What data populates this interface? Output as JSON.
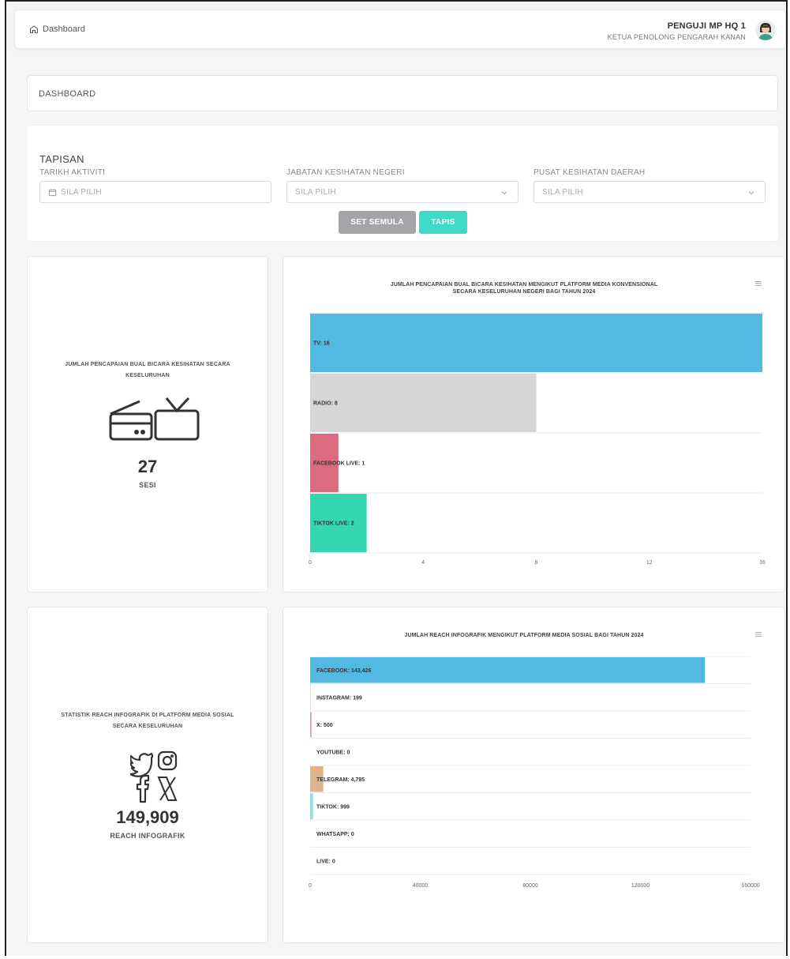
{
  "header": {
    "breadcrumb": "Dashboard",
    "user_name": "PENGUJI MP HQ 1",
    "user_role": "KETUA PENOLONG PENGARAH KANAN"
  },
  "page_title": "DASHBOARD",
  "filter": {
    "title": "TAPISAN",
    "fields": [
      {
        "label": "TARIKH AKTIVITI",
        "placeholder": "SILA PILIH"
      },
      {
        "label": "JABATAN KESIHATAN NEGERI",
        "placeholder": "SILA PILIH"
      },
      {
        "label": "PUSAT KESIHATAN DAERAH",
        "placeholder": "SILA PILIH"
      }
    ],
    "reset_label": "SET SEMULA",
    "apply_label": "TAPIS"
  },
  "stat1": {
    "title_line1": "JUMLAH PENCAPAIAN BUAL BICARA KESIHATAN SECARA",
    "title_line2": "KESELURUHAN",
    "value": "27",
    "unit": "SESI",
    "icons": [
      "radio-icon",
      "tv-icon"
    ]
  },
  "stat2": {
    "title_line1": "STATISTIK REACH INFOGRAFIK DI PLATFORM MEDIA SOSIAL",
    "title_line2": "SECARA KESELURUHAN",
    "value": "149,909",
    "unit": "REACH INFOGRAFIK",
    "icons": [
      "twitter-icon",
      "instagram-icon",
      "facebook-icon",
      "x-icon"
    ]
  },
  "chart_data": [
    {
      "type": "bar",
      "orientation": "horizontal",
      "title_line1": "JUMLAH PENCAPAIAN BUAL BICARA KESIHATAN MENGIKUT PLATFORM MEDIA KONVENSIONAL",
      "title_line2": "SECARA KESELURUHAN NEGERI BAGI TAHUN 2024",
      "categories": [
        "TV",
        "RADIO",
        "FACEBOOK LIVE",
        "TIKTOK LIVE"
      ],
      "values": [
        16,
        8,
        1,
        2
      ],
      "data_labels": [
        "TV: 16",
        "RADIO: 8",
        "FACEBOOK LIVE: 1",
        "TIKTOK LIVE: 2"
      ],
      "colors": [
        "#52b9e3",
        "#d6d6d6",
        "#dc6b7f",
        "#35d6b2"
      ],
      "xlim": [
        0,
        16
      ],
      "x_ticks": [
        "0",
        "4",
        "8",
        "12",
        "16"
      ]
    },
    {
      "type": "bar",
      "orientation": "horizontal",
      "title_line1": "JUMLAH REACH INFOGRAFIK MENGIKUT PLATFORM MEDIA SOSIAL BAGI TAHUN 2024",
      "categories": [
        "FACEBOOK",
        "INSTAGRAM",
        "X",
        "YOUTUBE",
        "TELEGRAM",
        "TIKTOK",
        "WHATSAPP",
        "LIVE"
      ],
      "values": [
        143426,
        199,
        500,
        0,
        4785,
        999,
        0,
        0
      ],
      "data_labels": [
        "FACEBOOK: 143,426",
        "INSTAGRAM: 199",
        "X: 500",
        "YOUTUBE: 0",
        "TELEGRAM: 4,785",
        "TIKTOK: 999",
        "WHATSAPP: 0",
        "LIVE: 0"
      ],
      "colors": [
        "#52b9e3",
        "#cfcfcf",
        "#e39aaa",
        "#cccccc",
        "#deb48c",
        "#7fe3e3",
        "#cccccc",
        "#cccccc"
      ],
      "xlim": [
        0,
        160000
      ],
      "x_ticks": [
        "0",
        "40000",
        "80000",
        "120000",
        "160000"
      ]
    }
  ]
}
